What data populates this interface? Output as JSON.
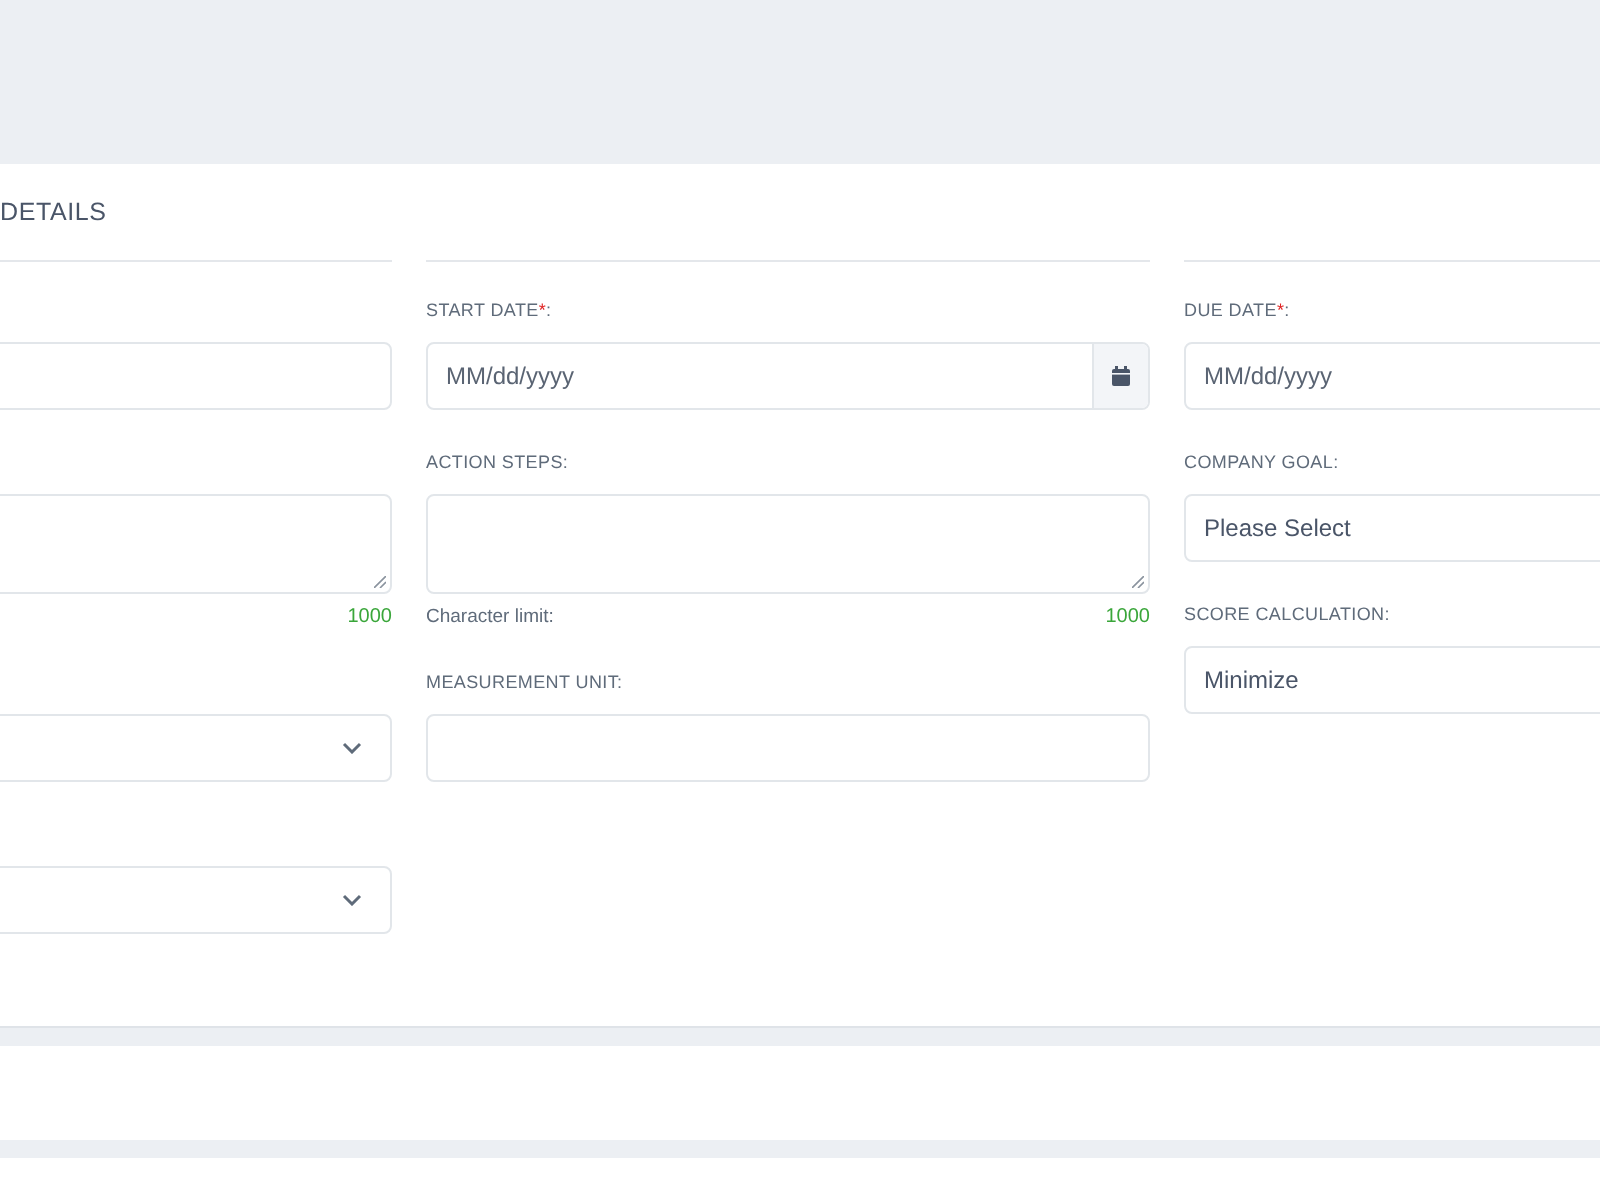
{
  "card": {
    "title": "DETAILS",
    "columns": [
      {
        "fields": [
          {
            "kind": "input"
          },
          {
            "kind": "textarea",
            "counter": "1000"
          },
          {
            "kind": "select",
            "chevron": true
          },
          {
            "kind": "select",
            "chevron": true
          }
        ]
      },
      {
        "fields": [
          {
            "kind": "date",
            "label": "START DATE",
            "required_mark": "*",
            "label_end": ":",
            "placeholder": "MM/dd/yyyy",
            "calendar_button": true
          },
          {
            "kind": "textarea",
            "label": "ACTION STEPS:",
            "counter_label": "Character limit:",
            "counter": "1000"
          },
          {
            "kind": "input",
            "label": "MEASUREMENT UNIT:"
          }
        ]
      },
      {
        "fields": [
          {
            "kind": "date",
            "label": "DUE DATE",
            "required_mark": "*",
            "label_end": ":",
            "placeholder": "MM/dd/yyyy"
          },
          {
            "kind": "select",
            "label": "COMPANY GOAL:",
            "value": "Please Select"
          },
          {
            "kind": "select",
            "label": "SCORE CALCULATION:",
            "value": "Minimize"
          }
        ]
      }
    ]
  }
}
